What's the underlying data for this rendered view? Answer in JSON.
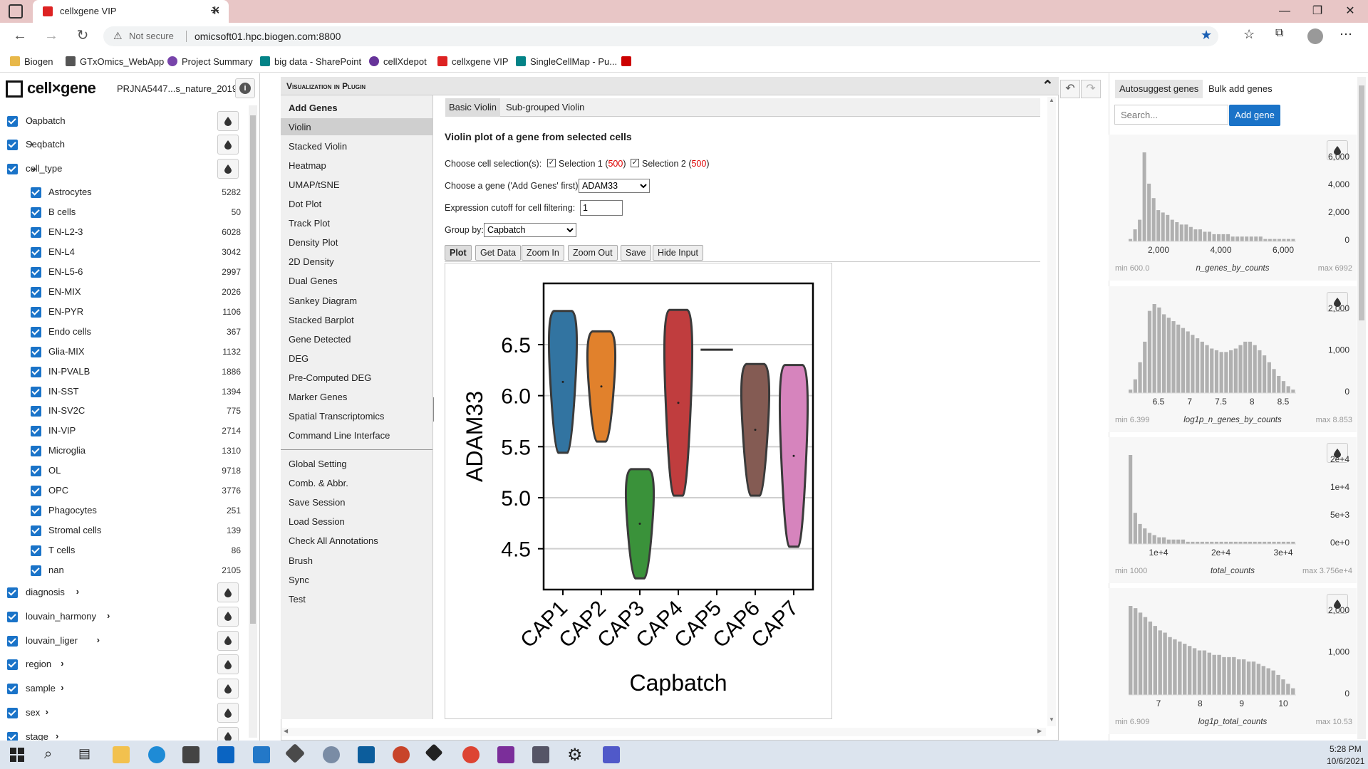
{
  "browser": {
    "tab_title": "cellxgene VIP",
    "security_label": "Not secure",
    "url": "omicsoft01.hpc.biogen.com:8800",
    "bookmarks": [
      "Biogen",
      "GTxOmics_WebApp",
      "Project Summary",
      "big data - SharePoint",
      "cellXdepot",
      "cellxgene VIP",
      "SingleCellMap - Pu..."
    ]
  },
  "app": {
    "logo_text": "cell×gene",
    "dataset_name": "PRJNA5447...s_nature_2019"
  },
  "categories": [
    {
      "label": "Capbatch",
      "expand": "›"
    },
    {
      "label": "Seqbatch",
      "expand": "›"
    },
    {
      "label": "cell_type",
      "expand": "⌄"
    }
  ],
  "cell_types": [
    {
      "label": "Astrocytes",
      "count": "5282"
    },
    {
      "label": "B cells",
      "count": "50"
    },
    {
      "label": "EN-L2-3",
      "count": "6028"
    },
    {
      "label": "EN-L4",
      "count": "3042"
    },
    {
      "label": "EN-L5-6",
      "count": "2997"
    },
    {
      "label": "EN-MIX",
      "count": "2026"
    },
    {
      "label": "EN-PYR",
      "count": "1106"
    },
    {
      "label": "Endo cells",
      "count": "367"
    },
    {
      "label": "Glia-MIX",
      "count": "1132"
    },
    {
      "label": "IN-PVALB",
      "count": "1886"
    },
    {
      "label": "IN-SST",
      "count": "1394"
    },
    {
      "label": "IN-SV2C",
      "count": "775"
    },
    {
      "label": "IN-VIP",
      "count": "2714"
    },
    {
      "label": "Microglia",
      "count": "1310"
    },
    {
      "label": "OL",
      "count": "9718"
    },
    {
      "label": "OPC",
      "count": "3776"
    },
    {
      "label": "Phagocytes",
      "count": "251"
    },
    {
      "label": "Stromal cells",
      "count": "139"
    },
    {
      "label": "T cells",
      "count": "86"
    },
    {
      "label": "nan",
      "count": "2105"
    }
  ],
  "lower_categories": [
    {
      "label": "diagnosis"
    },
    {
      "label": "louvain_harmony"
    },
    {
      "label": "louvain_liger"
    },
    {
      "label": "region"
    },
    {
      "label": "sample"
    },
    {
      "label": "sex"
    },
    {
      "label": "stage"
    }
  ],
  "plugin": {
    "title": "Visualization in Plugin",
    "menu_items": [
      "Add Genes",
      "Violin",
      "Stacked Violin",
      "Heatmap",
      "UMAP/tSNE",
      "Dot Plot",
      "Track Plot",
      "Density Plot",
      "2D Density",
      "Dual Genes",
      "Sankey Diagram",
      "Stacked Barplot",
      "Gene Detected",
      "DEG",
      "Pre-Computed DEG",
      "Marker Genes",
      "Spatial Transcriptomics",
      "Command Line Interface"
    ],
    "menu_items_2": [
      "Global Setting",
      "Comb. & Abbr.",
      "Save Session",
      "Load Session",
      "Check All Annotations",
      "Brush",
      "Sync",
      "Test"
    ],
    "tabs": [
      "Basic Violin",
      "Sub-grouped Violin"
    ],
    "heading": "Violin plot of a gene from selected cells",
    "cell_selection_label": "Choose cell selection(s):",
    "selection1_label": "Selection 1 (",
    "selection1_count": "500",
    "selection2_label": "Selection 2 (",
    "selection2_count": "500",
    "close_paren": ")",
    "gene_label": "Choose a gene ('Add Genes' first):",
    "gene_value": "ADAM33",
    "cutoff_label": "Expression cutoff for cell filtering:",
    "cutoff_value": "1",
    "groupby_label": "Group by:",
    "groupby_value": "Capbatch",
    "buttons": [
      "Plot",
      "Get Data",
      "Zoom In",
      "Zoom Out",
      "Save",
      "Hide Input"
    ]
  },
  "chart_data": {
    "type": "violin",
    "xlabel": "Capbatch",
    "ylabel": "ADAM33",
    "ylim": [
      4.1,
      7.1
    ],
    "yticks": [
      "4.5",
      "5.0",
      "5.5",
      "6.0",
      "6.5"
    ],
    "grid": true,
    "categories": [
      "CAP1",
      "CAP2",
      "CAP3",
      "CAP4",
      "CAP5",
      "CAP6",
      "CAP7"
    ],
    "series": [
      {
        "category": "CAP1",
        "min": 5.44,
        "max": 6.83,
        "color": "#3274a1"
      },
      {
        "category": "CAP2",
        "min": 5.55,
        "max": 6.63,
        "color": "#e1812c"
      },
      {
        "category": "CAP3",
        "min": 4.21,
        "max": 5.28,
        "color": "#3a923a"
      },
      {
        "category": "CAP4",
        "min": 5.02,
        "max": 6.84,
        "color": "#c03d3e"
      },
      {
        "category": "CAP5",
        "min": 6.45,
        "max": 6.45,
        "color": "#9372b2"
      },
      {
        "category": "CAP6",
        "min": 5.02,
        "max": 6.31,
        "color": "#845b53"
      },
      {
        "category": "CAP7",
        "min": 4.52,
        "max": 6.3,
        "color": "#d684bd"
      }
    ]
  },
  "right_panel": {
    "tabs": [
      "Autosuggest genes",
      "Bulk add genes"
    ],
    "search_placeholder": "Search...",
    "add_button": "Add gene",
    "histograms": [
      {
        "name": "n_genes_by_counts",
        "min": "min 600.0",
        "max": "max 6992",
        "xticks": [
          "2,000",
          "4,000",
          "6,000"
        ],
        "yticks": [
          "6,000",
          "4,000",
          "2,000",
          "0"
        ],
        "bins": [
          1,
          5,
          9,
          37,
          24,
          18,
          13,
          12,
          11,
          9,
          8,
          7,
          7,
          6,
          5,
          5,
          4,
          4,
          3,
          3,
          3,
          3,
          2,
          2,
          2,
          2,
          2,
          2,
          2,
          1,
          1,
          1,
          1,
          1,
          1,
          1
        ]
      },
      {
        "name": "log1p_n_genes_by_counts",
        "min": "min 6.399",
        "max": "max 8.853",
        "xticks": [
          "6.5",
          "7",
          "7.5",
          "8",
          "8.5"
        ],
        "yticks": [
          "2,000",
          "1,000",
          "0"
        ],
        "bins": [
          2,
          8,
          18,
          30,
          48,
          52,
          50,
          46,
          44,
          42,
          40,
          38,
          36,
          34,
          32,
          30,
          28,
          26,
          25,
          24,
          24,
          25,
          26,
          28,
          30,
          30,
          28,
          25,
          22,
          18,
          14,
          10,
          7,
          4,
          2
        ]
      },
      {
        "name": "total_counts",
        "min": "min 1000",
        "max": "max 3.756e+4",
        "xticks": [
          "1e+4",
          "2e+4",
          "3e+4"
        ],
        "yticks": [
          "2e+4",
          "1e+4",
          "5e+3",
          "0e+0"
        ],
        "bins": [
          40,
          14,
          9,
          7,
          5,
          4,
          3,
          3,
          2,
          2,
          2,
          2,
          1,
          1,
          1,
          1,
          1,
          1,
          1,
          1,
          1,
          1,
          1,
          1,
          1,
          1,
          1,
          1,
          1,
          1,
          1,
          1,
          1,
          1,
          1
        ]
      },
      {
        "name": "log1p_total_counts",
        "min": "min 6.909",
        "max": "max 10.53",
        "xticks": [
          "7",
          "8",
          "9",
          "10"
        ],
        "yticks": [
          "2,000",
          "1,000",
          "0"
        ],
        "bins": [
          40,
          39,
          37,
          35,
          33,
          31,
          29,
          28,
          26,
          25,
          24,
          23,
          22,
          21,
          20,
          20,
          19,
          18,
          18,
          17,
          17,
          17,
          16,
          16,
          15,
          15,
          14,
          13,
          12,
          11,
          9,
          7,
          5,
          3
        ]
      }
    ]
  },
  "system": {
    "time": "5:28 PM",
    "date": "10/6/2021"
  }
}
